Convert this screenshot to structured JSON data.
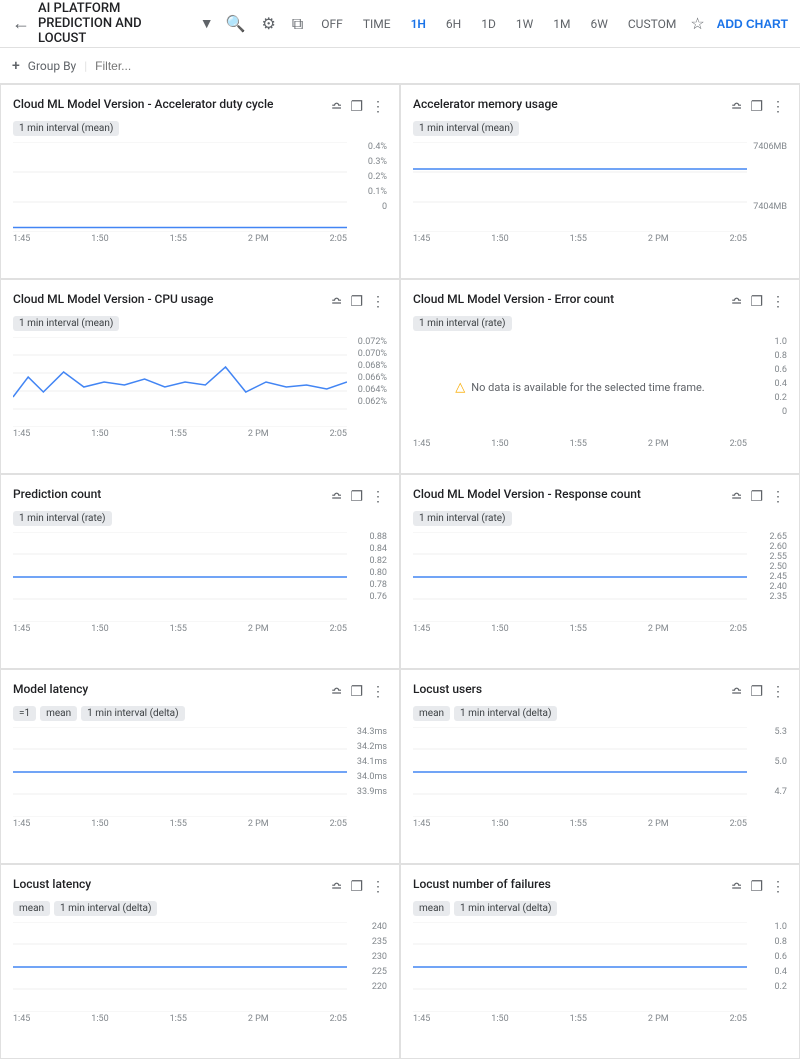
{
  "nav": {
    "back_icon": "←",
    "title": "AI PLATFORM PREDICTION AND LOCUST",
    "dropdown_icon": "▾",
    "search_icon": "⌕",
    "settings_icon": "⚙",
    "resize_icon": "⛶",
    "off_label": "OFF",
    "time_options": [
      "TIME",
      "1H",
      "6H",
      "1D",
      "1W",
      "1M",
      "6W",
      "CUSTOM"
    ],
    "active_time": "1H",
    "star_icon": "☆",
    "add_chart_label": "ADD CHART"
  },
  "filter_bar": {
    "plus_icon": "+",
    "group_by_label": "Group By",
    "filter_placeholder": "Filter..."
  },
  "charts": [
    {
      "id": "chart1",
      "title": "Cloud ML Model Version - Accelerator duty cycle",
      "tags": [
        "1 min interval (mean)"
      ],
      "y_labels": [
        "0.4%",
        "0.3%",
        "0.2%",
        "0.1%",
        "0"
      ],
      "x_labels": [
        "1:45",
        "1:50",
        "1:55",
        "2 PM",
        "2:05"
      ],
      "has_data": true,
      "flat": true,
      "line_y": 0.95
    },
    {
      "id": "chart2",
      "title": "Accelerator memory usage",
      "tags": [
        "1 min interval (mean)"
      ],
      "y_labels": [
        "7406MB",
        "",
        "",
        "",
        "7404MB"
      ],
      "x_labels": [
        "1:45",
        "1:50",
        "1:55",
        "2 PM",
        "2:05"
      ],
      "has_data": true,
      "flat": true,
      "line_y": 0.3
    },
    {
      "id": "chart3",
      "title": "Cloud ML Model Version - CPU usage",
      "tags": [
        "1 min interval (mean)"
      ],
      "y_labels": [
        "0.072%",
        "0.070%",
        "0.068%",
        "0.066%",
        "0.064%",
        "0.062%"
      ],
      "x_labels": [
        "1:45",
        "1:50",
        "1:55",
        "2 PM",
        "2:05"
      ],
      "has_data": true,
      "wavy": true
    },
    {
      "id": "chart4",
      "title": "Cloud ML Model Version - Error count",
      "tags": [
        "1 min interval (rate)"
      ],
      "y_labels": [
        "1.0",
        "0.8",
        "0.6",
        "0.4",
        "0.2",
        "0"
      ],
      "x_labels": [
        "1:45",
        "1:50",
        "1:55",
        "2 PM",
        "2:05"
      ],
      "has_data": false,
      "no_data_message": "No data is available for the selected time frame."
    },
    {
      "id": "chart5",
      "title": "Prediction count",
      "tags": [
        "1 min interval (rate)"
      ],
      "y_labels": [
        "0.88",
        "0.84",
        "0.82",
        "0.80",
        "0.78",
        "0.76"
      ],
      "x_labels": [
        "1:45",
        "1:50",
        "1:55",
        "2 PM",
        "2:05"
      ],
      "has_data": true,
      "flat2": true
    },
    {
      "id": "chart6",
      "title": "Cloud ML Model Version - Response count",
      "tags": [
        "1 min interval (rate)"
      ],
      "y_labels": [
        "2.65",
        "2.60",
        "2.55",
        "2.50",
        "2.45",
        "2.40",
        "2.35"
      ],
      "x_labels": [
        "1:45",
        "1:50",
        "1:55",
        "2 PM",
        "2:05"
      ],
      "has_data": true,
      "flat2": true
    },
    {
      "id": "chart7",
      "title": "Model latency",
      "tags": [
        "=1",
        "mean",
        "1 min interval (delta)"
      ],
      "y_labels": [
        "34.3ms",
        "34.2ms",
        "34.1ms",
        "34.0ms",
        "33.9ms"
      ],
      "x_labels": [
        "1:45",
        "1:50",
        "1:55",
        "2 PM",
        "2:05"
      ],
      "has_data": true,
      "flat2": true
    },
    {
      "id": "chart8",
      "title": "Locust users",
      "tags": [
        "mean",
        "1 min interval (delta)"
      ],
      "y_labels": [
        "5.3",
        "",
        "5.0",
        "",
        "4.7"
      ],
      "x_labels": [
        "1:45",
        "1:50",
        "1:55",
        "2 PM",
        "2:05"
      ],
      "has_data": true,
      "flat2": true
    },
    {
      "id": "chart9",
      "title": "Locust latency",
      "tags": [
        "mean",
        "1 min interval (delta)"
      ],
      "y_labels": [
        "240",
        "235",
        "230",
        "225",
        "220"
      ],
      "x_labels": [
        "1:45",
        "1:50",
        "1:55",
        "2 PM",
        "2:05"
      ],
      "has_data": true,
      "flat2": true
    },
    {
      "id": "chart10",
      "title": "Locust number of failures",
      "tags": [
        "mean",
        "1 min interval (delta)"
      ],
      "y_labels": [
        "1.0",
        "0.8",
        "0.6",
        "0.4",
        "0.2"
      ],
      "x_labels": [
        "1:45",
        "1:50",
        "1:55",
        "2 PM",
        "2:05"
      ],
      "has_data": true,
      "flat2": true
    }
  ]
}
